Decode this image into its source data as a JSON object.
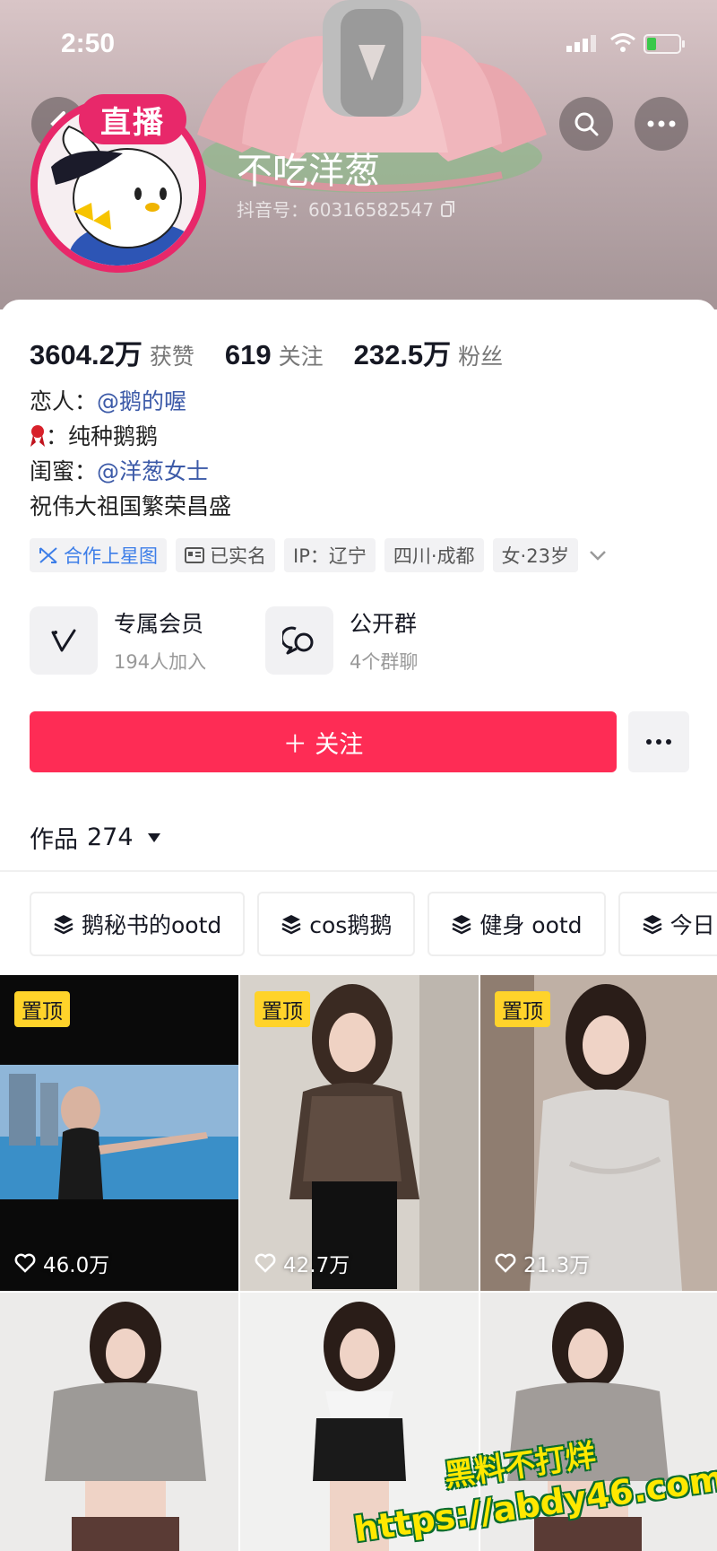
{
  "status_bar": {
    "time": "2:50"
  },
  "profile": {
    "live_label": "直播",
    "name": "不吃洋葱",
    "douyin_id": "抖音号：60316582547"
  },
  "stats": [
    {
      "value": "3604.2万",
      "label": "获赞"
    },
    {
      "value": "619",
      "label": "关注"
    },
    {
      "value": "232.5万",
      "label": "粉丝"
    }
  ],
  "bio": {
    "line1_prefix": "恋人：",
    "line1_link": "@鹅的喔",
    "line2_text": "：纯种鹅鹅",
    "line3_prefix": "闺蜜：",
    "line3_link": "@洋葱女士",
    "line4": "祝伟大祖国繁荣昌盛"
  },
  "tags": [
    "合作上星图",
    "已实名",
    "IP：辽宁",
    "四川·成都",
    "女·23岁"
  ],
  "features": [
    {
      "title": "专属会员",
      "subtitle": "194人加入",
      "icon": "v-icon"
    },
    {
      "title": "公开群",
      "subtitle": "4个群聊",
      "icon": "chat-icon"
    }
  ],
  "follow_button": "＋ 关注",
  "works": {
    "label": "作品",
    "count": "274"
  },
  "collections": [
    "鹅秘书的ootd",
    "cos鹅鹅",
    "健身 ootd",
    "今日"
  ],
  "videos": [
    {
      "pinned": "置顶",
      "likes": "46.0万"
    },
    {
      "pinned": "置顶",
      "likes": "42.7万"
    },
    {
      "pinned": "置顶",
      "likes": "21.3万"
    },
    {
      "pinned": "",
      "likes": ""
    },
    {
      "pinned": "",
      "likes": ""
    },
    {
      "pinned": "",
      "likes": ""
    }
  ],
  "watermark": {
    "line1": "黑料不打烊",
    "line2": "https://abdy46.com"
  },
  "colors": {
    "accent": "#fe2c55",
    "live": "#e8286a",
    "link": "#3c5aa8",
    "pinned": "#ffd32a"
  }
}
